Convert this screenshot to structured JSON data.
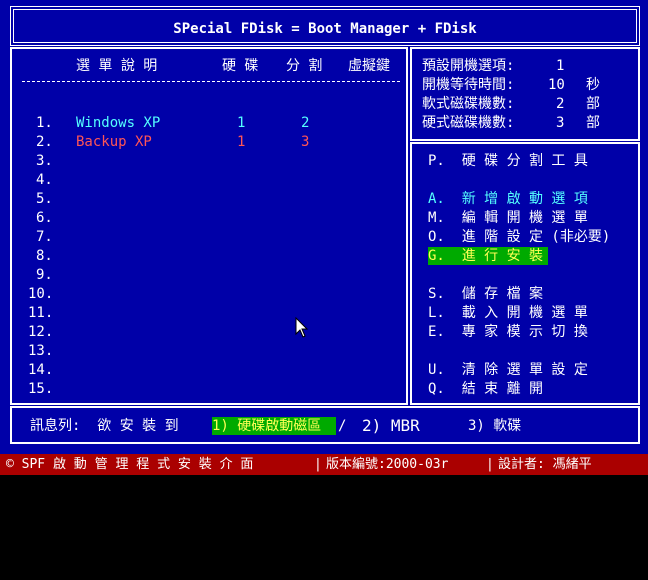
{
  "header": {
    "title": "SPecial FDisk = Boot Manager + FDisk"
  },
  "table": {
    "headers": {
      "desc": "選 單 說 明",
      "disk": "硬 碟",
      "part": "分 割",
      "key": "虛擬鍵"
    },
    "rows": [
      {
        "num": "1.",
        "name": "Windows XP",
        "disk": "1",
        "part": "2"
      },
      {
        "num": "2.",
        "name": "Backup XP",
        "disk": "1",
        "part": "3"
      },
      {
        "num": "3."
      },
      {
        "num": "4."
      },
      {
        "num": "5."
      },
      {
        "num": "6."
      },
      {
        "num": "7."
      },
      {
        "num": "8."
      },
      {
        "num": "9."
      },
      {
        "num": "10."
      },
      {
        "num": "11."
      },
      {
        "num": "12."
      },
      {
        "num": "13."
      },
      {
        "num": "14."
      },
      {
        "num": "15."
      }
    ]
  },
  "settings": [
    {
      "label": "預設開機選項:",
      "value": "1",
      "unit": ""
    },
    {
      "label": "開機等待時間:",
      "value": "10",
      "unit": "秒"
    },
    {
      "label": "軟式磁碟機數:",
      "value": "2",
      "unit": "部"
    },
    {
      "label": "硬式磁碟機數:",
      "value": "3",
      "unit": "部"
    }
  ],
  "menu": {
    "p": "P.  硬 碟 分 割 工 具",
    "a": "A.  新 增 啟 動 選 項",
    "m": "M.  編 輯 開 機 選 單",
    "o": "O.  進 階 設 定 (非必要)",
    "g": "G.  進 行 安 裝",
    "s": "S.  儲 存 檔 案",
    "l": "L.  載 入 開 機 選 單",
    "e": "E.  專 家 模 示 切 換",
    "u": "U.  清 除 選 單 設 定",
    "q": "Q.  結 束 離 開"
  },
  "message": {
    "label": "訊息列:  欲 安 裝 到",
    "opt1": "1) 硬碟啟動磁區",
    "opt2": "2) MBR",
    "opt3": "3) 軟碟"
  },
  "statusbar": {
    "left": "© SPF 啟 動 管 理 程 式 安 裝 介 面",
    "version": "版本編號:2000-03r",
    "designer": "設計者: 馮緒平"
  },
  "colors": {
    "background": "#0000A8",
    "cyan": "#55FFFF",
    "red": "#FF5555",
    "highlight": "#00AA00",
    "status": "#AA0000"
  }
}
